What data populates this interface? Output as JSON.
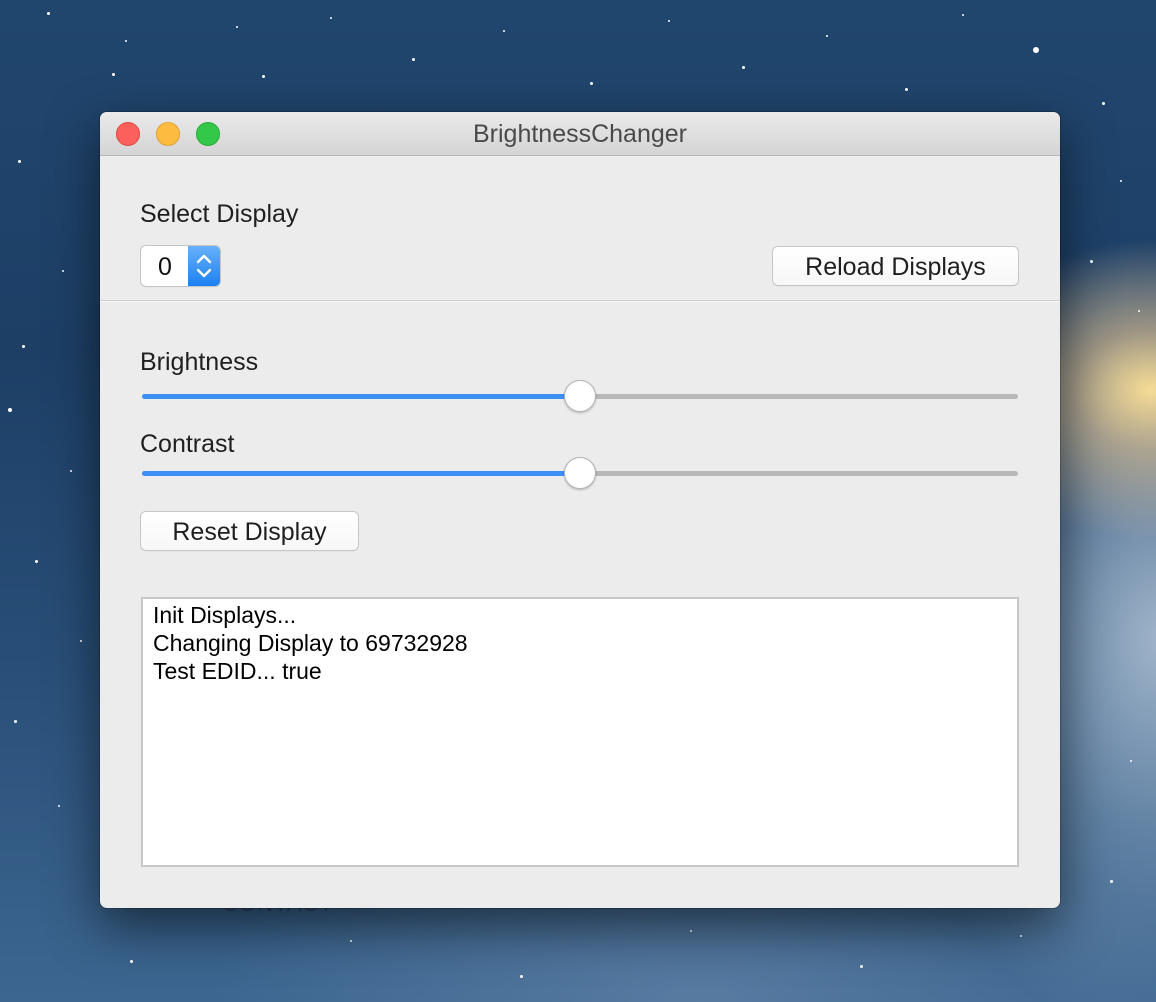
{
  "window": {
    "title": "BrightnessChanger"
  },
  "display_select": {
    "label": "Select Display",
    "value": "0",
    "reload_button": "Reload Displays"
  },
  "brightness": {
    "label": "Brightness",
    "level": 0.5
  },
  "contrast": {
    "label": "Contrast",
    "level": 0.5
  },
  "reset_button": "Reset Display",
  "log": {
    "lines": [
      "Init Displays...",
      "Changing Display to 69732928",
      "Test EDID... true"
    ]
  },
  "background": {
    "text": "CONTACT"
  },
  "colors": {
    "accent": "#3b8ff5",
    "traffic_close": "#fc605c",
    "traffic_minimize": "#fdbc40",
    "traffic_zoom": "#34c84a"
  }
}
